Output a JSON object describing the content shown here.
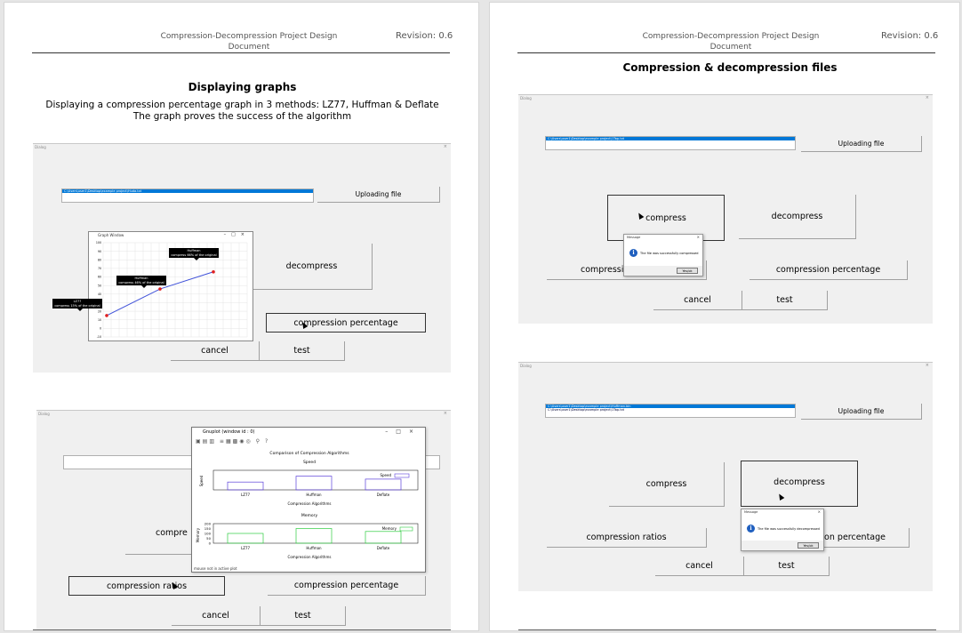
{
  "header": {
    "title": "Compression-Decompression Project Design Document",
    "revision": "Revision: 0.6"
  },
  "left_page": {
    "heading": "Displaying graphs",
    "paragraph_line1": "Displaying a compression percentage graph in 3 methods: LZ77, Huffman & Deflate",
    "paragraph_line2": "The graph proves the success of the algorithm",
    "dialog1": {
      "title": "Dialog",
      "path": "C:\\Users\\user1\\Desktop\\example project\\Huda.txt",
      "uploading": "Uploading file",
      "decompress": "decompress",
      "compression_percentage": "compression percentage",
      "cancel": "cancel",
      "test": "test",
      "graph_window": {
        "title": "Graph Window",
        "callouts": [
          {
            "name": "LZ77",
            "desc": "compress 15% of the original"
          },
          {
            "name": "Huffman",
            "desc": "compress 46% of the original"
          },
          {
            "name": "Huffman",
            "desc": "compress 66% of the original"
          }
        ],
        "y_ticks": [
          "100",
          "90",
          "80",
          "70",
          "60",
          "50",
          "40",
          "30",
          "20",
          "10",
          "0",
          "-10"
        ]
      }
    },
    "dialog2": {
      "title": "Dialog",
      "compress_partial": "compre",
      "compression_ratios": "compression ratios",
      "compression_percentage": "compression percentage",
      "cancel": "cancel",
      "test": "test",
      "gnuplot": {
        "title": "Gnuplot (window id : 0)",
        "status": "mouse not in active plot",
        "chart_title": "Comparison of Compression Algorithms",
        "speed_title": "Speed",
        "speed_ylabel": "Speed",
        "speed_legend": "Speed",
        "memory_title": "Memory",
        "memory_ylabel": "Memory",
        "memory_legend": "Memory",
        "xlabel": "Compression Algorithms",
        "memory_ticks": [
          "200",
          "150",
          "100",
          "50",
          "0"
        ]
      }
    }
  },
  "right_page": {
    "heading": "Compression & decompression files",
    "dialog1": {
      "title": "Dialog",
      "path": "C:\\Users\\user1\\Desktop\\example project\\1Tap.txt",
      "uploading": "Uploading file",
      "compress": "compress",
      "decompress": "decompress",
      "compression_partial": "compressio",
      "compression_percentage": "compression percentage",
      "cancel": "cancel",
      "test": "test",
      "message": {
        "title": "Message",
        "text": "The file was successfully compressed",
        "ok": "Yes/ok"
      }
    },
    "dialog2": {
      "title": "Dialog",
      "path": "C:\\Users\\user1\\Desktop\\example project\\Huffman.bin",
      "path2": "C:\\Users\\user1\\Desktop\\example project\\1Tap.txt",
      "uploading": "Uploading file",
      "compress": "compress",
      "decompress": "decompress",
      "compression_ratios": "compression ratios",
      "compression_percentage_partial": "ession percentage",
      "cancel": "cancel",
      "test": "test",
      "message": {
        "title": "Message",
        "text": "The file was successfully decompressed",
        "ok": "Yes/ok"
      }
    }
  },
  "chart_data": [
    {
      "type": "line",
      "x": [
        "LZ77",
        "Huffman",
        "Huffman"
      ],
      "values": [
        15,
        46,
        66
      ],
      "ylim": [
        -10,
        100
      ]
    },
    {
      "type": "bar",
      "title": "Comparison of Compression Algorithms",
      "subtitle": "Speed",
      "categories": [
        "LZ77",
        "Huffman",
        "Deflate"
      ],
      "series": [
        {
          "name": "Speed",
          "values": [
            0.8,
            1.4,
            1.1
          ]
        }
      ],
      "xlabel": "Compression Algorithms",
      "ylabel": "Speed"
    },
    {
      "type": "bar",
      "title": "Memory",
      "categories": [
        "LZ77",
        "Huffman",
        "Deflate"
      ],
      "series": [
        {
          "name": "Memory",
          "values": [
            100,
            150,
            120
          ]
        }
      ],
      "xlabel": "Compression Algorithms",
      "ylabel": "Memory",
      "ylim": [
        0,
        200
      ]
    }
  ]
}
